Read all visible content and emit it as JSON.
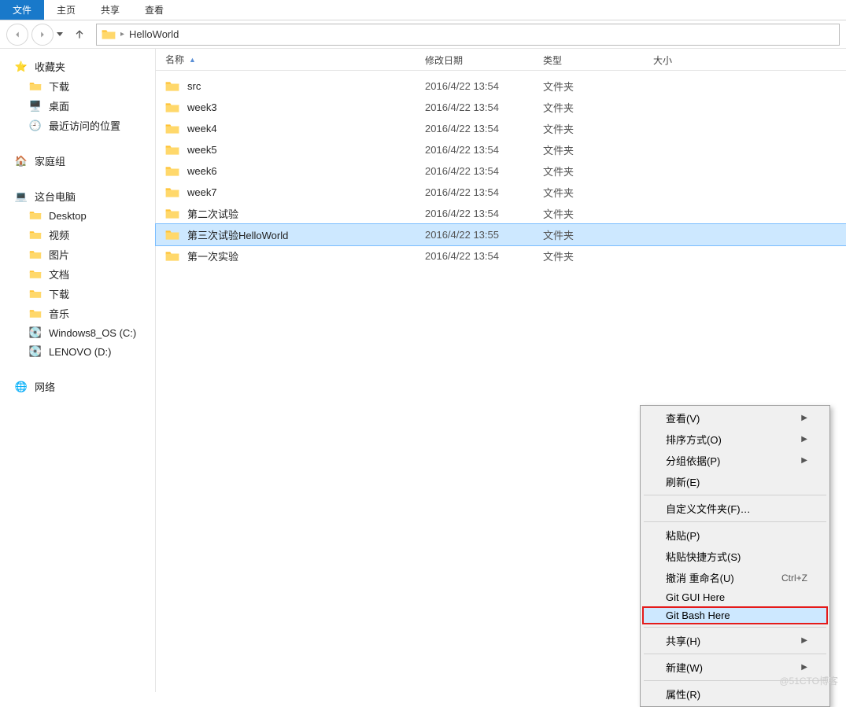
{
  "ribbon": {
    "tabs": [
      "文件",
      "主页",
      "共享",
      "查看"
    ],
    "active_index": 0
  },
  "breadcrumb": {
    "folder": "HelloWorld"
  },
  "sidebar": {
    "favorites": {
      "label": "收藏夹",
      "items": [
        "下载",
        "桌面",
        "最近访问的位置"
      ]
    },
    "homegroup": {
      "label": "家庭组"
    },
    "thispc": {
      "label": "这台电脑",
      "items": [
        "Desktop",
        "视频",
        "图片",
        "文档",
        "下载",
        "音乐",
        "Windows8_OS (C:)",
        "LENOVO (D:)"
      ]
    },
    "network": {
      "label": "网络"
    }
  },
  "columns": {
    "name": "名称",
    "date": "修改日期",
    "type": "类型",
    "size": "大小"
  },
  "files": [
    {
      "name": "src",
      "date": "2016/4/22 13:54",
      "type": "文件夹"
    },
    {
      "name": "week3",
      "date": "2016/4/22 13:54",
      "type": "文件夹"
    },
    {
      "name": "week4",
      "date": "2016/4/22 13:54",
      "type": "文件夹"
    },
    {
      "name": "week5",
      "date": "2016/4/22 13:54",
      "type": "文件夹"
    },
    {
      "name": "week6",
      "date": "2016/4/22 13:54",
      "type": "文件夹"
    },
    {
      "name": "week7",
      "date": "2016/4/22 13:54",
      "type": "文件夹"
    },
    {
      "name": "第二次试验",
      "date": "2016/4/22 13:54",
      "type": "文件夹"
    },
    {
      "name": "第三次试验HelloWorld",
      "date": "2016/4/22 13:55",
      "type": "文件夹",
      "selected": true
    },
    {
      "name": "第一次实验",
      "date": "2016/4/22 13:54",
      "type": "文件夹"
    }
  ],
  "context_menu": {
    "items": [
      {
        "label": "查看(V)",
        "submenu": true
      },
      {
        "label": "排序方式(O)",
        "submenu": true
      },
      {
        "label": "分组依据(P)",
        "submenu": true
      },
      {
        "label": "刷新(E)"
      },
      {
        "sep": true
      },
      {
        "label": "自定义文件夹(F)…"
      },
      {
        "sep": true
      },
      {
        "label": "粘贴(P)"
      },
      {
        "label": "粘贴快捷方式(S)"
      },
      {
        "label": "撤消 重命名(U)",
        "shortcut": "Ctrl+Z"
      },
      {
        "label": "Git GUI Here"
      },
      {
        "label": "Git Bash Here",
        "highlight": true
      },
      {
        "sep": true
      },
      {
        "label": "共享(H)",
        "submenu": true
      },
      {
        "sep": true
      },
      {
        "label": "新建(W)",
        "submenu": true
      },
      {
        "sep": true
      },
      {
        "label": "属性(R)"
      }
    ]
  },
  "watermark": "@51CTO博客"
}
